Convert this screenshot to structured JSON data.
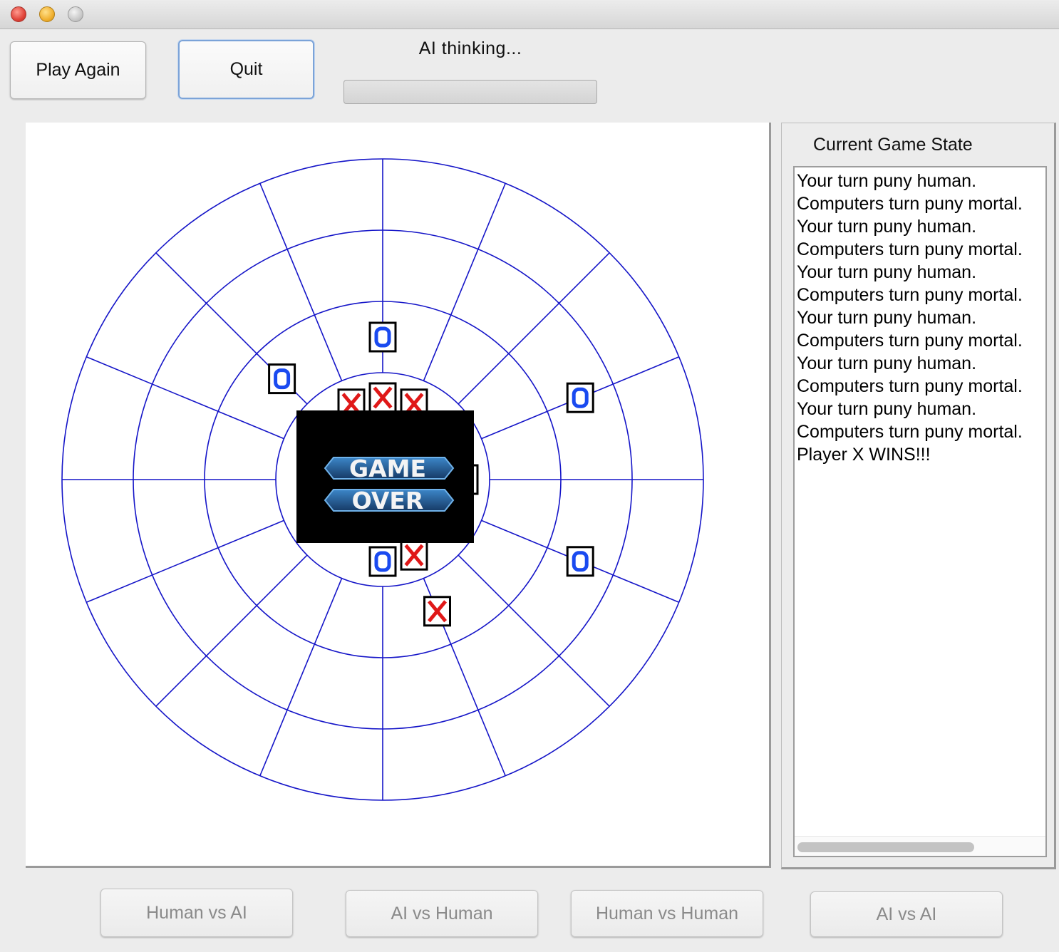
{
  "window": {
    "title": ""
  },
  "toolbar": {
    "play_again_label": "Play Again",
    "quit_label": "Quit",
    "status_label": "AI thinking...",
    "progress": 0
  },
  "board": {
    "rings": 4,
    "sectors": 16,
    "line_color": "#1515c8",
    "x_color": "#e01818",
    "o_color": "#1a4af0",
    "pieces": [
      {
        "mark": "O",
        "ring": 1,
        "sector": 0
      },
      {
        "mark": "X",
        "ring": 0,
        "sector": 0
      },
      {
        "mark": "X",
        "ring": 0,
        "sector": 1
      },
      {
        "mark": "X",
        "ring": 0,
        "sector": 15
      },
      {
        "mark": "O",
        "ring": 1,
        "sector": 14
      },
      {
        "mark": "O",
        "ring": 2,
        "sector": 3
      },
      {
        "mark": "X",
        "ring": 0,
        "sector": 3
      },
      {
        "mark": "O",
        "ring": 0,
        "sector": 4
      },
      {
        "mark": "X",
        "ring": 0,
        "sector": 5
      },
      {
        "mark": "O",
        "ring": 2,
        "sector": 5
      },
      {
        "mark": "X",
        "ring": 0,
        "sector": 7
      },
      {
        "mark": "O",
        "ring": 0,
        "sector": 8
      },
      {
        "mark": "X",
        "ring": 1,
        "sector": 7
      }
    ],
    "overlay": {
      "line1": "GAME",
      "line2": "OVER"
    }
  },
  "side_panel": {
    "title": "Current Game State",
    "log": [
      "Your turn puny human.",
      "Computers turn puny mortal.",
      "Your turn puny human.",
      "Computers turn puny mortal.",
      "Your turn puny human.",
      "Computers turn puny mortal.",
      "Your turn puny human.",
      "Computers turn puny mortal.",
      "Your turn puny human.",
      "Computers turn puny mortal.",
      "Your turn puny human.",
      "Computers turn puny mortal.",
      "Player X WINS!!!"
    ]
  },
  "modes": {
    "human_vs_ai": "Human vs AI",
    "ai_vs_human": "AI vs Human",
    "human_vs_human": "Human vs Human",
    "ai_vs_ai": "AI vs AI"
  }
}
